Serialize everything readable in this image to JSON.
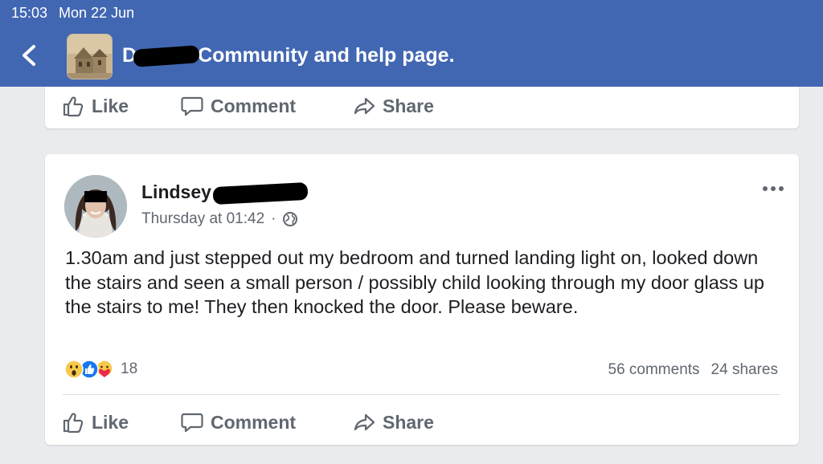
{
  "status_bar": {
    "time": "15:03",
    "date": "Mon 22 Jun"
  },
  "header": {
    "title_prefix": "D",
    "title_suffix": "Community and help page.",
    "back_icon": "chevron-left-icon",
    "accent": "#4267b2"
  },
  "previous_post": {
    "actions": {
      "like": "Like",
      "comment": "Comment",
      "share": "Share"
    }
  },
  "post": {
    "author_first_name": "Lindsey",
    "timestamp": "Thursday at 01:42",
    "separator": "·",
    "privacy_icon": "globe-icon",
    "text": "1.30am and just stepped out my bedroom and turned landing light on, looked down the stairs and seen a small person / possibly child looking through my door glass up the stairs to me! They then knocked the door. Please beware.",
    "reactions": [
      "wow",
      "like",
      "care"
    ],
    "reaction_count": "18",
    "comments": "56 comments",
    "shares": "24 shares",
    "actions": {
      "like": "Like",
      "comment": "Comment",
      "share": "Share"
    }
  }
}
